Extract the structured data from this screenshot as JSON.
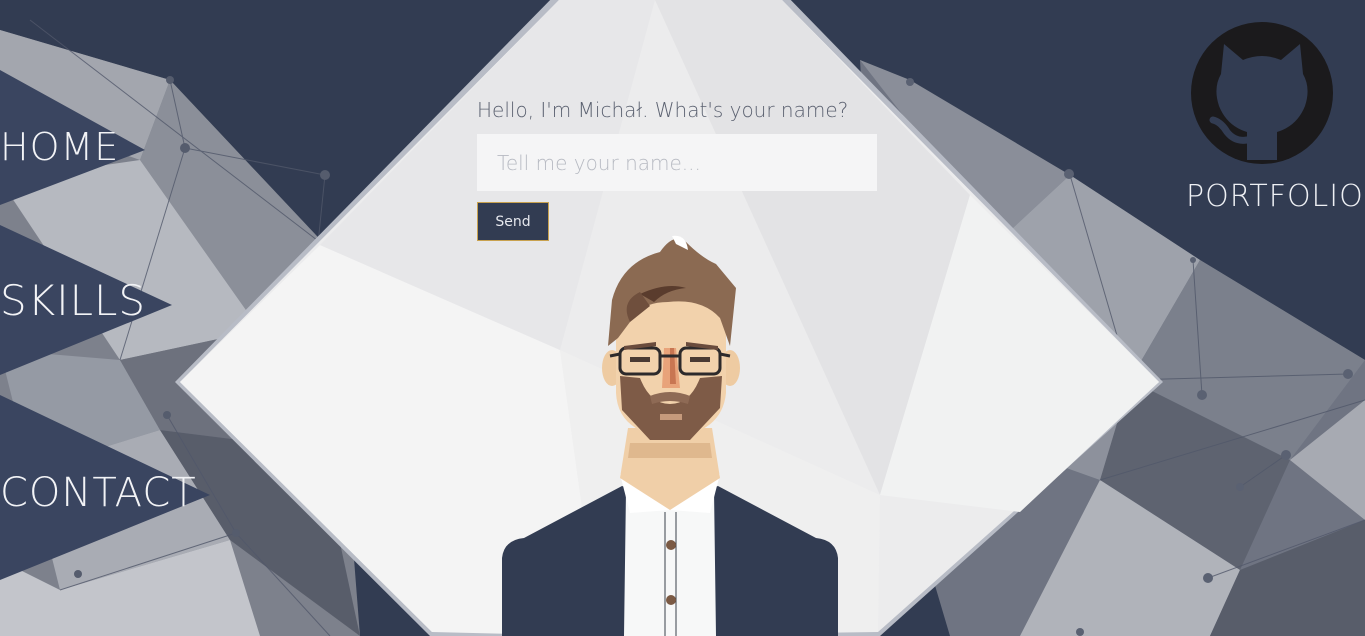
{
  "nav": {
    "items": [
      {
        "label": "HOME"
      },
      {
        "label": "SKILLS"
      },
      {
        "label": "CONTACT"
      }
    ]
  },
  "form": {
    "greeting": "Hello, I'm Michał. What's your name?",
    "name_placeholder": "Tell me your name...",
    "name_value": "",
    "send_label": "Send"
  },
  "portfolio": {
    "label": "PORTFOLIO",
    "icon": "github-octocat-icon"
  },
  "avatar": {
    "icon": "character-illustration"
  },
  "colors": {
    "background": "#323c52",
    "panel": "#ededee",
    "accent_border": "#c9a24f",
    "text_light": "#f2f3f6",
    "text_muted": "#5b6170"
  }
}
